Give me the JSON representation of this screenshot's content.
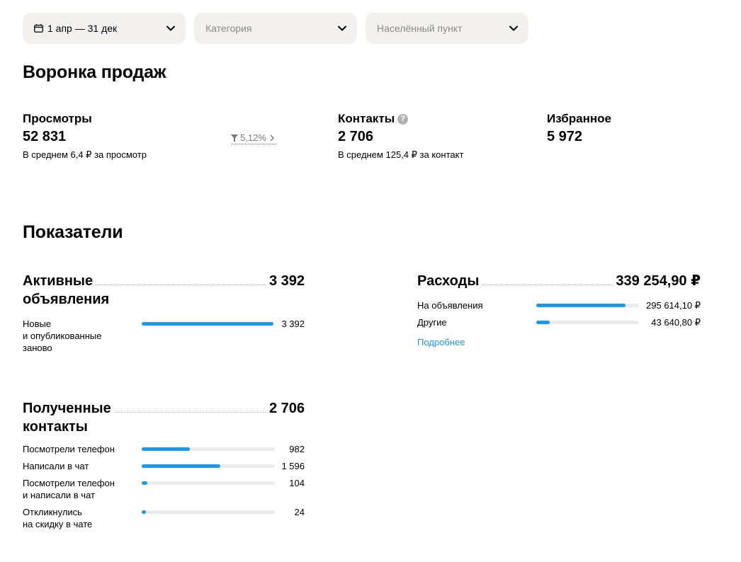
{
  "filters": {
    "period": "1 апр — 31 дек",
    "category": "Категория",
    "city": "Населённый пункт"
  },
  "funnel": {
    "title": "Воронка продаж",
    "views": {
      "title": "Просмотры",
      "value": "52 831",
      "sub": "В среднем 6,4 ₽ за просмотр"
    },
    "conversion": "5,12%",
    "contacts": {
      "title": "Контакты",
      "value": "2 706",
      "sub": "В среднем 125,4 ₽ за контакт"
    },
    "favorites": {
      "title": "Избранное",
      "value": "5 972"
    }
  },
  "metrics": {
    "title": "Показатели",
    "active": {
      "title_line1": "Активные",
      "title_line2": "объявления",
      "total": "3 392",
      "rows": [
        {
          "label": "Новые\nи опубликованные\nзаново",
          "value": "3 392",
          "fraction": 1.0
        }
      ]
    },
    "expenses": {
      "title": "Расходы",
      "total": "339 254,90 ₽",
      "rows": [
        {
          "label": "На объявления",
          "value": "295 614,10 ₽",
          "fraction": 0.87
        },
        {
          "label": "Другие",
          "value": "43 640,80 ₽",
          "fraction": 0.13
        }
      ],
      "more": "Подробнее"
    },
    "contacts": {
      "title_line1": "Полученные",
      "title_line2": "контакты",
      "total": "2 706",
      "rows": [
        {
          "label": "Посмотрели телефон",
          "value": "982",
          "fraction": 0.36
        },
        {
          "label": "Написали в чат",
          "value": "1 596",
          "fraction": 0.59
        },
        {
          "label": "Посмотрели телефон\nи написали в чат",
          "value": "104",
          "fraction": 0.04
        },
        {
          "label": "Откликнулись\nна скидку в чате",
          "value": "24",
          "fraction": 0.01
        }
      ]
    }
  },
  "colors": {
    "accent": "#1b98e8",
    "bar_track": "#ebebeb",
    "filter_bg": "#f2f1f0"
  }
}
